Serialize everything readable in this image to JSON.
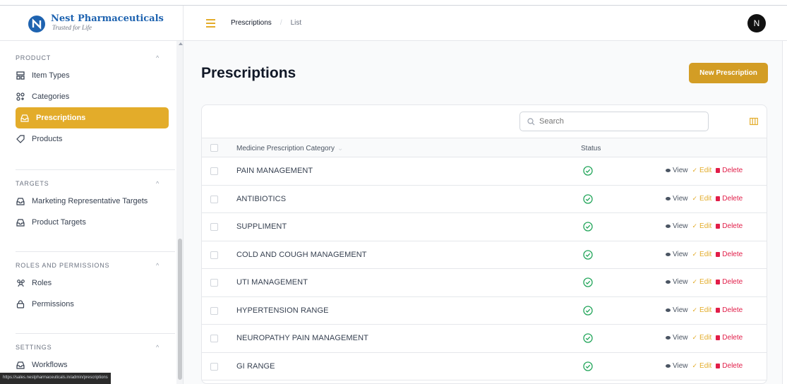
{
  "brand": {
    "name": "Nest Pharmaceuticals",
    "tagline": "Trusted for Life"
  },
  "sidebar": {
    "groups": [
      {
        "label": "PRODUCT",
        "items": [
          {
            "label": "Item Types",
            "icon": "grid-icon"
          },
          {
            "label": "Categories",
            "icon": "categories-icon"
          },
          {
            "label": "Prescriptions",
            "icon": "tray-icon",
            "active": true
          },
          {
            "label": "Products",
            "icon": "tag-icon"
          }
        ]
      },
      {
        "label": "TARGETS",
        "items": [
          {
            "label": "Marketing Representative Targets",
            "icon": "tray-icon"
          },
          {
            "label": "Product Targets",
            "icon": "tray-icon"
          }
        ]
      },
      {
        "label": "ROLES AND PERMISSIONS",
        "items": [
          {
            "label": "Roles",
            "icon": "users-icon"
          },
          {
            "label": "Permissions",
            "icon": "lock-icon"
          }
        ]
      },
      {
        "label": "SETTINGS",
        "items": [
          {
            "label": "Workflows",
            "icon": "tray-icon"
          }
        ]
      }
    ],
    "status_url": "https://sales.nestpharmaceuticals.in/admin/prescriptions"
  },
  "topbar": {
    "breadcrumb": [
      "Prescriptions",
      "List"
    ],
    "avatar_initial": "N"
  },
  "page": {
    "title": "Prescriptions",
    "new_button": "New Prescription"
  },
  "table": {
    "search_placeholder": "Search",
    "columns": [
      "Medicine Prescription Category",
      "Status"
    ],
    "actions": {
      "view": "View",
      "edit": "Edit",
      "delete": "Delete"
    },
    "rows": [
      {
        "name": "PAIN MANAGEMENT",
        "status": "active"
      },
      {
        "name": "ANTIBIOTICS",
        "status": "active"
      },
      {
        "name": "SUPPLIMENT",
        "status": "active"
      },
      {
        "name": "COLD AND COUGH MANAGEMENT",
        "status": "active"
      },
      {
        "name": "UTI MANAGEMENT",
        "status": "active"
      },
      {
        "name": "HYPERTENSION RANGE",
        "status": "active"
      },
      {
        "name": "NEUROPATHY PAIN MANAGEMENT",
        "status": "active"
      },
      {
        "name": "GI RANGE",
        "status": "active"
      }
    ]
  },
  "colors": {
    "accent": "#e3ac2a",
    "button": "#d39d25",
    "success": "#22a55a",
    "danger": "#e11d48",
    "brand": "#1e63b0"
  }
}
